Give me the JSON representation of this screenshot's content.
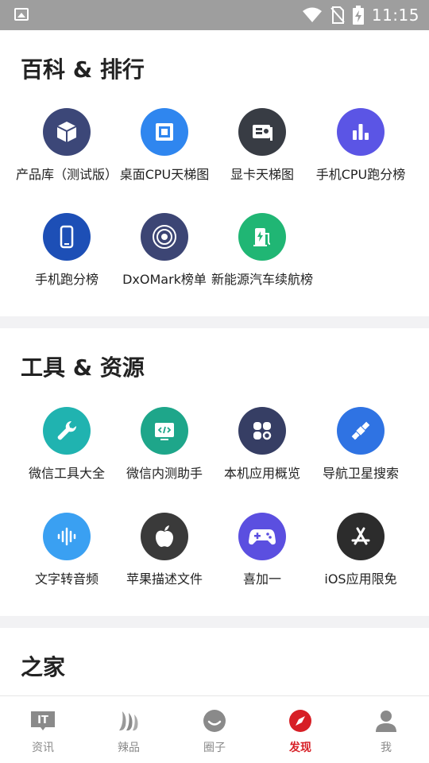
{
  "status_bar": {
    "time": "11:15"
  },
  "sections": [
    {
      "title": "百科 & 排行",
      "items": [
        {
          "label": "产品库（测试版）",
          "icon": "box-icon",
          "color": "#3c4778"
        },
        {
          "label": "桌面CPU天梯图",
          "icon": "cpu-chip-icon",
          "color": "#2f86ef"
        },
        {
          "label": "显卡天梯图",
          "icon": "graphics-card-icon",
          "color": "#383c44"
        },
        {
          "label": "手机CPU跑分榜",
          "icon": "bar-chart-icon",
          "color": "#5b55e5"
        },
        {
          "label": "手机跑分榜",
          "icon": "smartphone-icon",
          "color": "#1d4fb6"
        },
        {
          "label": "DxOMark榜单",
          "icon": "camera-lens-icon",
          "color": "#3c4574"
        },
        {
          "label": "新能源汽车续航榜",
          "icon": "ev-charger-icon",
          "color": "#20b674"
        }
      ]
    },
    {
      "title": "工具 & 资源",
      "items": [
        {
          "label": "微信工具大全",
          "icon": "wrench-icon",
          "color": "#20b3b0"
        },
        {
          "label": "微信内测助手",
          "icon": "code-window-icon",
          "color": "#1ea68a"
        },
        {
          "label": "本机应用概览",
          "icon": "apps-grid-icon",
          "color": "#363e64"
        },
        {
          "label": "导航卫星搜索",
          "icon": "satellite-icon",
          "color": "#2f73e3"
        },
        {
          "label": "文字转音频",
          "icon": "audio-wave-icon",
          "color": "#3aa0f2"
        },
        {
          "label": "苹果描述文件",
          "icon": "apple-icon",
          "color": "#3a3a3a"
        },
        {
          "label": "喜加一",
          "icon": "gamepad-icon",
          "color": "#5b4fe0"
        },
        {
          "label": "iOS应用限免",
          "icon": "app-store-icon",
          "color": "#2c2c2c"
        }
      ]
    },
    {
      "title": "之家"
    }
  ],
  "tab_bar": {
    "items": [
      {
        "label": "资讯",
        "icon": "it-news-icon"
      },
      {
        "label": "辣品",
        "icon": "chili-icon"
      },
      {
        "label": "圈子",
        "icon": "smile-icon"
      },
      {
        "label": "发现",
        "icon": "compass-icon",
        "active": true
      },
      {
        "label": "我",
        "icon": "user-icon"
      }
    ]
  },
  "colors": {
    "accent": "#d71f26",
    "tab_inactive": "#8a8a8a"
  }
}
